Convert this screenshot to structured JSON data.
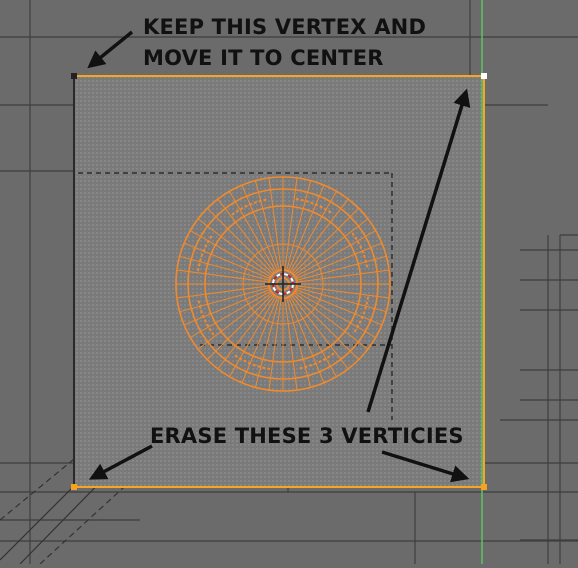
{
  "annotations": {
    "keep_line1": "KEEP THIS VERTEX AND",
    "keep_line2": "MOVE IT TO CENTER",
    "erase": "ERASE THESE 3 VERTICIES"
  },
  "colors": {
    "background": "#6b6b6b",
    "grid_line": "#3e3e3e",
    "plane_fill": "#7a7a7a",
    "selected_edge": "#f5a623",
    "selected_vertex": "#f7a21d",
    "unselected_vertex": "#222222",
    "active_vertex": "#ffffff",
    "mesh_wire": "#f08a2c",
    "y_axis": "#5ec35e",
    "arrow": "#111111",
    "annotation_text": "#111111"
  },
  "icons": {
    "pointer_arrows": "arrow-icon",
    "3d_cursor": "3d-cursor-icon"
  }
}
